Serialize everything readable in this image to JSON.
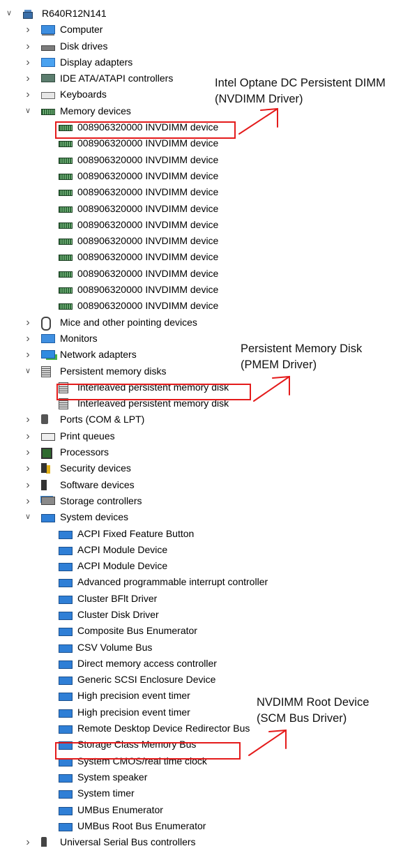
{
  "root": {
    "label": "R640R12N141",
    "expanded": true
  },
  "categories_top": [
    {
      "label": "Computer",
      "icon": "computer-icon"
    },
    {
      "label": "Disk drives",
      "icon": "disk-drive-icon"
    },
    {
      "label": "Display adapters",
      "icon": "display-adapter-icon"
    },
    {
      "label": "IDE ATA/ATAPI controllers",
      "icon": "ide-controller-icon"
    },
    {
      "label": "Keyboards",
      "icon": "keyboard-icon"
    }
  ],
  "memory": {
    "label": "Memory devices",
    "icon": "memory-icon",
    "expanded": true,
    "items": [
      "008906320000 INVDIMM device",
      "008906320000 INVDIMM device",
      "008906320000 INVDIMM device",
      "008906320000 INVDIMM device",
      "008906320000 INVDIMM device",
      "008906320000 INVDIMM device",
      "008906320000 INVDIMM device",
      "008906320000 INVDIMM device",
      "008906320000 INVDIMM device",
      "008906320000 INVDIMM device",
      "008906320000 INVDIMM device",
      "008906320000 INVDIMM device"
    ]
  },
  "categories_mid": [
    {
      "label": "Mice and other pointing devices",
      "icon": "mouse-icon"
    },
    {
      "label": "Monitors",
      "icon": "monitor-icon"
    },
    {
      "label": "Network adapters",
      "icon": "network-adapter-icon"
    }
  ],
  "pmem": {
    "label": "Persistent memory disks",
    "icon": "pmem-disk-icon",
    "expanded": true,
    "items": [
      "Interleaved persistent memory disk",
      "Interleaved persistent memory disk"
    ]
  },
  "categories_mid2": [
    {
      "label": "Ports (COM & LPT)",
      "icon": "port-icon"
    },
    {
      "label": "Print queues",
      "icon": "printer-icon"
    },
    {
      "label": "Processors",
      "icon": "processor-icon"
    },
    {
      "label": "Security devices",
      "icon": "security-device-icon"
    },
    {
      "label": "Software devices",
      "icon": "software-device-icon"
    },
    {
      "label": "Storage controllers",
      "icon": "storage-controller-icon"
    }
  ],
  "system": {
    "label": "System devices",
    "icon": "system-device-icon",
    "expanded": true,
    "items": [
      "ACPI Fixed Feature Button",
      "ACPI Module Device",
      "ACPI Module Device",
      "Advanced programmable interrupt controller",
      "Cluster BFlt Driver",
      "Cluster Disk Driver",
      "Composite Bus Enumerator",
      "CSV Volume Bus",
      "Direct memory access controller",
      "Generic SCSI Enclosure Device",
      "High precision event timer",
      "High precision event timer",
      "Remote Desktop Device Redirector Bus",
      "Storage Class Memory Bus",
      "System CMOS/real time clock",
      "System speaker",
      "System timer",
      "UMBus Enumerator",
      "UMBus Root Bus Enumerator"
    ]
  },
  "categories_bottom": [
    {
      "label": "Universal Serial Bus controllers",
      "icon": "usb-icon"
    }
  ],
  "annotations": {
    "nvdimm": [
      "Intel Optane DC Persistent DIMM",
      "(NVDIMM Driver)"
    ],
    "pmem": [
      "Persistent Memory Disk",
      "(PMEM Driver)"
    ],
    "scm": [
      "NVDIMM Root Device",
      "(SCM Bus Driver)"
    ]
  },
  "colors": {
    "highlight": "#e41b1b",
    "chevron": "#555555"
  }
}
